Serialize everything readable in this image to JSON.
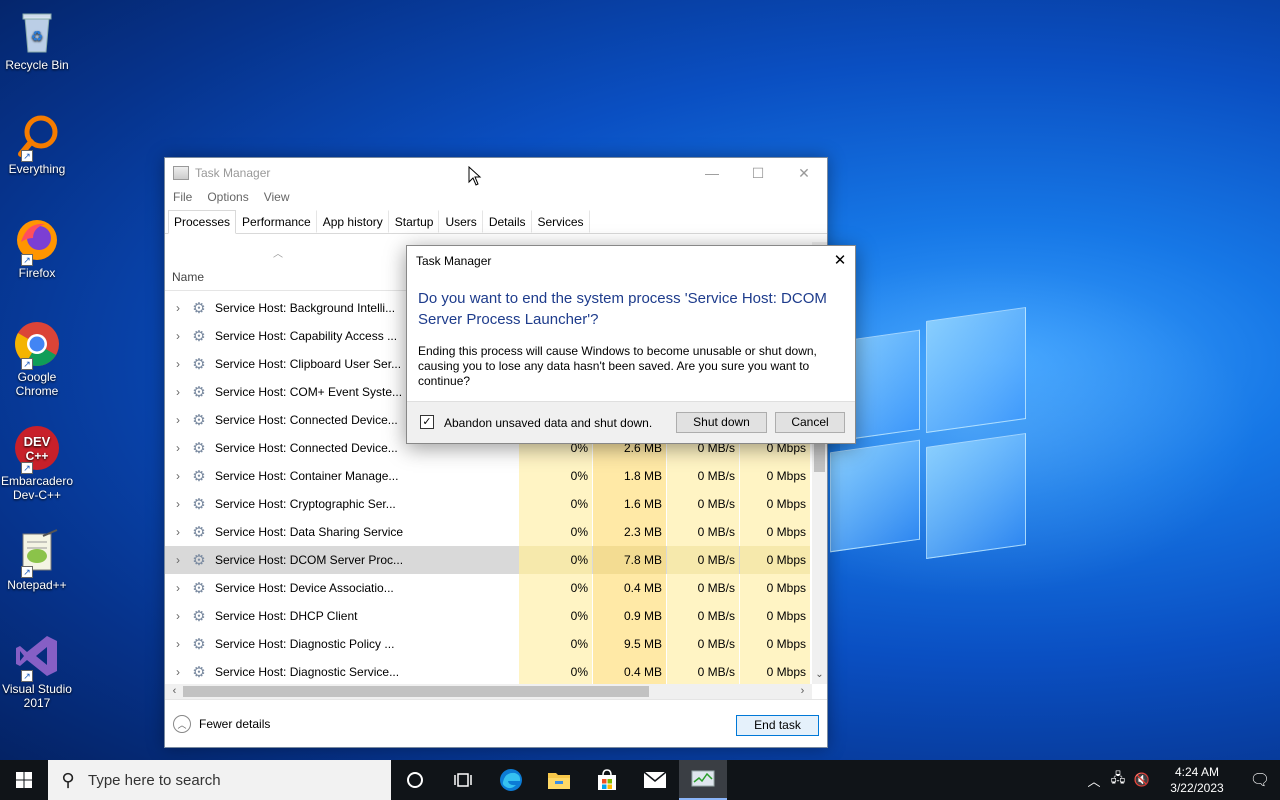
{
  "desktop": {
    "icons": [
      {
        "label": "Recycle Bin",
        "icon": "recycle-bin-icon"
      },
      {
        "label": "Everything",
        "icon": "everything-search-icon"
      },
      {
        "label": "Firefox",
        "icon": "firefox-icon"
      },
      {
        "label": "Google Chrome",
        "icon": "chrome-icon"
      },
      {
        "label": "Embarcadero Dev-C++",
        "icon": "devcpp-icon",
        "glyph": "DEV C++"
      },
      {
        "label": "Notepad++",
        "icon": "notepadpp-icon"
      },
      {
        "label": "Visual Studio 2017",
        "icon": "visual-studio-icon"
      }
    ]
  },
  "task_manager": {
    "title": "Task Manager",
    "menu": [
      "File",
      "Options",
      "View"
    ],
    "tabs": [
      "Processes",
      "Performance",
      "App history",
      "Startup",
      "Users",
      "Details",
      "Services"
    ],
    "active_tab": "Processes",
    "column_name": "Name",
    "rows": [
      {
        "name": "Service Host: Background Intelli...",
        "cpu": "",
        "mem": "",
        "disk": "",
        "net": ""
      },
      {
        "name": "Service Host: Capability Access ...",
        "cpu": "",
        "mem": "",
        "disk": "",
        "net": ""
      },
      {
        "name": "Service Host: Clipboard User Ser...",
        "cpu": "",
        "mem": "",
        "disk": "",
        "net": ""
      },
      {
        "name": "Service Host: COM+ Event Syste...",
        "cpu": "",
        "mem": "",
        "disk": "",
        "net": ""
      },
      {
        "name": "Service Host: Connected Device...",
        "cpu": "",
        "mem": "",
        "disk": "",
        "net": ""
      },
      {
        "name": "Service Host: Connected Device...",
        "cpu": "0%",
        "mem": "2.6 MB",
        "disk": "0 MB/s",
        "net": "0 Mbps"
      },
      {
        "name": "Service Host: Container Manage...",
        "cpu": "0%",
        "mem": "1.8 MB",
        "disk": "0 MB/s",
        "net": "0 Mbps"
      },
      {
        "name": "Service Host: Cryptographic Ser...",
        "cpu": "0%",
        "mem": "1.6 MB",
        "disk": "0 MB/s",
        "net": "0 Mbps"
      },
      {
        "name": "Service Host: Data Sharing Service",
        "cpu": "0%",
        "mem": "2.3 MB",
        "disk": "0 MB/s",
        "net": "0 Mbps"
      },
      {
        "name": "Service Host: DCOM Server Proc...",
        "cpu": "0%",
        "mem": "7.8 MB",
        "disk": "0 MB/s",
        "net": "0 Mbps",
        "selected": true
      },
      {
        "name": "Service Host: Device Associatio...",
        "cpu": "0%",
        "mem": "0.4 MB",
        "disk": "0 MB/s",
        "net": "0 Mbps"
      },
      {
        "name": "Service Host: DHCP Client",
        "cpu": "0%",
        "mem": "0.9 MB",
        "disk": "0 MB/s",
        "net": "0 Mbps"
      },
      {
        "name": "Service Host: Diagnostic Policy ...",
        "cpu": "0%",
        "mem": "9.5 MB",
        "disk": "0 MB/s",
        "net": "0 Mbps"
      },
      {
        "name": "Service Host: Diagnostic Service...",
        "cpu": "0%",
        "mem": "0.4 MB",
        "disk": "0 MB/s",
        "net": "0 Mbps"
      }
    ],
    "fewer_details": "Fewer details",
    "end_task": "End task"
  },
  "dialog": {
    "title": "Task Manager",
    "heading": "Do you want to end the system process 'Service Host: DCOM Server Process Launcher'?",
    "body": "Ending this process will cause Windows to become unusable or shut down, causing you to lose any data hasn't been saved. Are you sure you want to continue?",
    "checkbox_label": "Abandon unsaved data and shut down.",
    "checkbox_checked": true,
    "shutdown_label": "Shut down",
    "cancel_label": "Cancel"
  },
  "taskbar": {
    "search_placeholder": "Type here to search",
    "time": "4:24 AM",
    "date": "3/22/2023"
  },
  "colors": {
    "accent": "#0078d7",
    "dialog_heading": "#1e3c8c",
    "cpu_cell": "#fff4c4",
    "mem_cell": "#ffe9a6"
  }
}
